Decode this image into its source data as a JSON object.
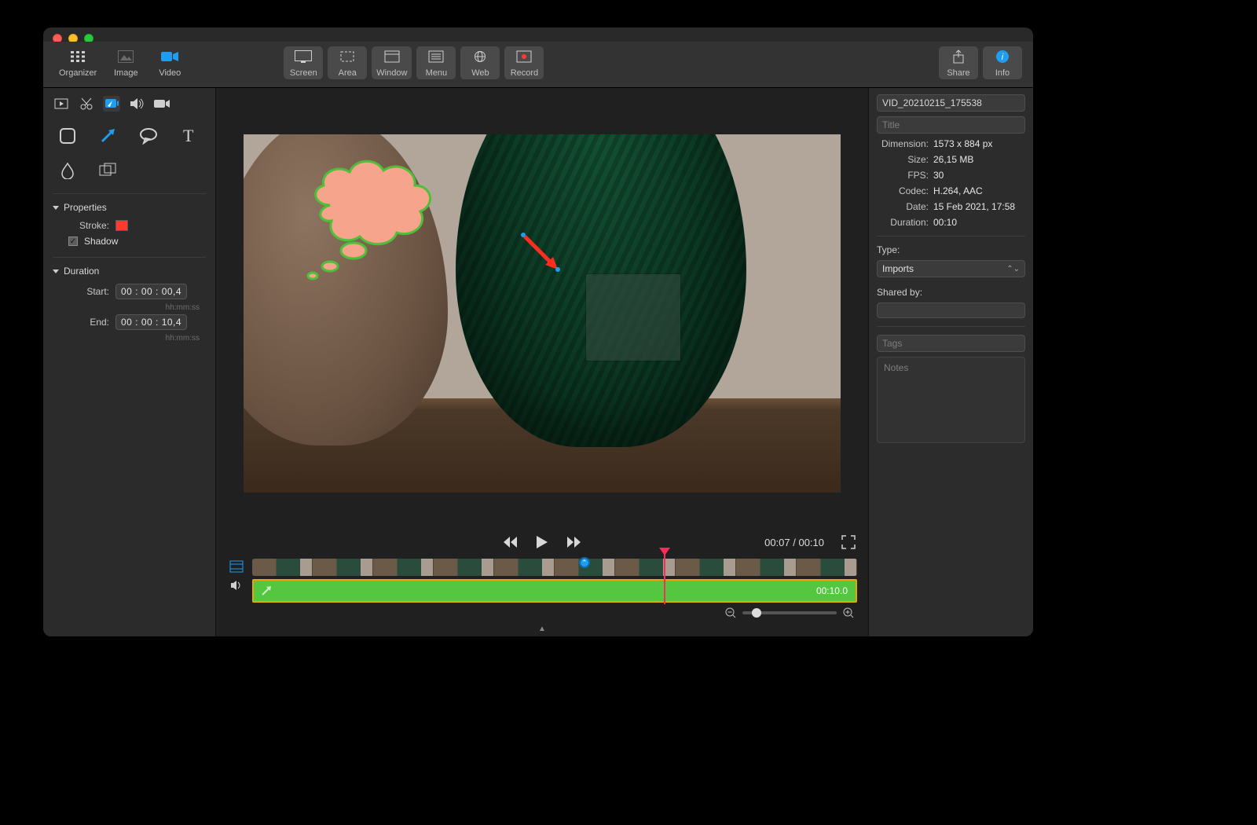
{
  "toolbar": {
    "modes": {
      "organizer": "Organizer",
      "image": "Image",
      "video": "Video"
    },
    "capture": {
      "screen": "Screen",
      "area": "Area",
      "window": "Window",
      "menu": "Menu",
      "web": "Web",
      "record": "Record"
    },
    "right": {
      "share": "Share",
      "info": "Info"
    }
  },
  "left": {
    "properties_header": "Properties",
    "stroke_label": "Stroke:",
    "stroke_color": "#ff3b30",
    "shadow_label": "Shadow",
    "shadow_checked": true,
    "duration_header": "Duration",
    "start_label": "Start:",
    "start_value": "00 : 00 : 00,4",
    "end_label": "End:",
    "end_value": "00 : 00 : 10,4",
    "time_hint": "hh:mm:ss"
  },
  "player": {
    "time_readout": "00:07 / 00:10"
  },
  "timeline": {
    "clip_duration": "00:10.0"
  },
  "info": {
    "filename": "VID_20210215_175538",
    "title_placeholder": "Title",
    "dimension_label": "Dimension:",
    "dimension": "1573 x 884 px",
    "size_label": "Size:",
    "size": "26,15 MB",
    "fps_label": "FPS:",
    "fps": "30",
    "codec_label": "Codec:",
    "codec": "H.264, AAC",
    "date_label": "Date:",
    "date": "15 Feb 2021, 17:58",
    "duration_label": "Duration:",
    "duration": "00:10",
    "type_label": "Type:",
    "type_value": "Imports",
    "shared_by_label": "Shared by:",
    "tags_placeholder": "Tags",
    "notes_placeholder": "Notes"
  }
}
